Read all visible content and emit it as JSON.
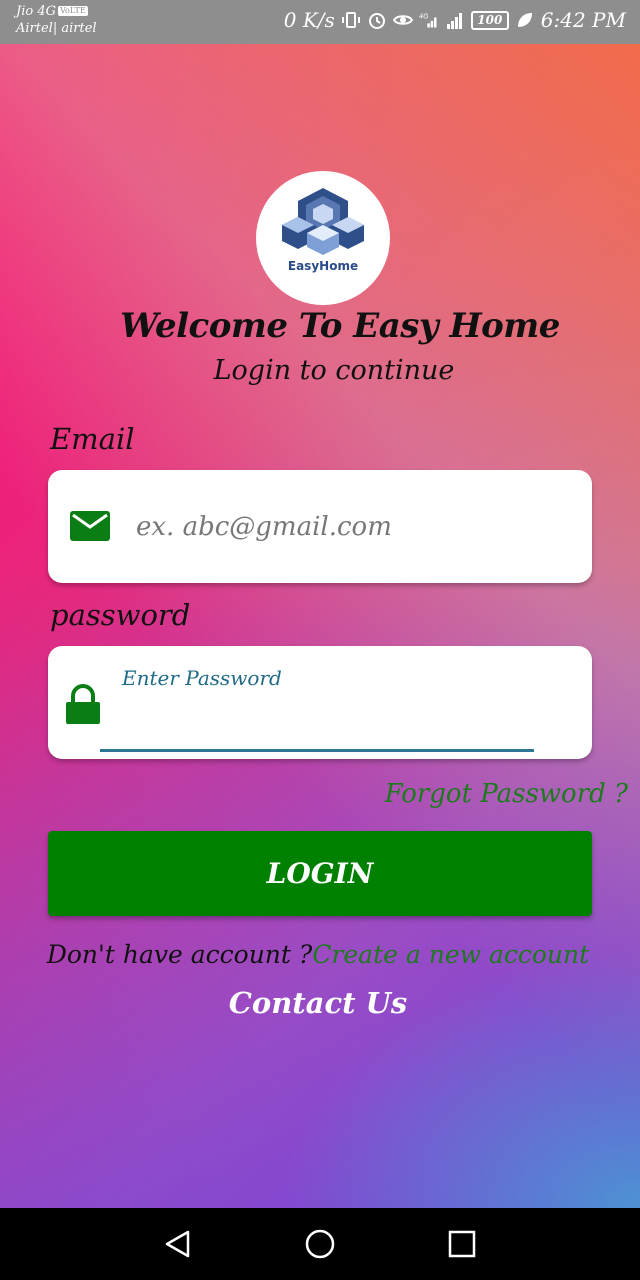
{
  "status_bar": {
    "carrier_line1": "Jio 4G",
    "volte_badge": "VoLTE",
    "carrier_line2": "Airtel| airtel",
    "net_speed": "0 K/s",
    "battery": "100",
    "time": "6:42 PM"
  },
  "app": {
    "logo_text": "EasyHome",
    "title": "Welcome To Easy Home",
    "subtitle": "Login to continue"
  },
  "email": {
    "label": "Email",
    "placeholder": "ex. abc@gmail.com",
    "value": ""
  },
  "password": {
    "label": "password",
    "hint": "Enter Password",
    "value": ""
  },
  "links": {
    "forgot": "Forgot Password ?",
    "no_account": "Don't have account ?",
    "create_account": "Create a new account",
    "contact": "Contact Us"
  },
  "buttons": {
    "login": "LOGIN"
  },
  "colors": {
    "accent_green": "#008000",
    "input_underline": "#2b7695"
  },
  "icons": {
    "email": "envelope-icon",
    "password": "lock-icon"
  }
}
